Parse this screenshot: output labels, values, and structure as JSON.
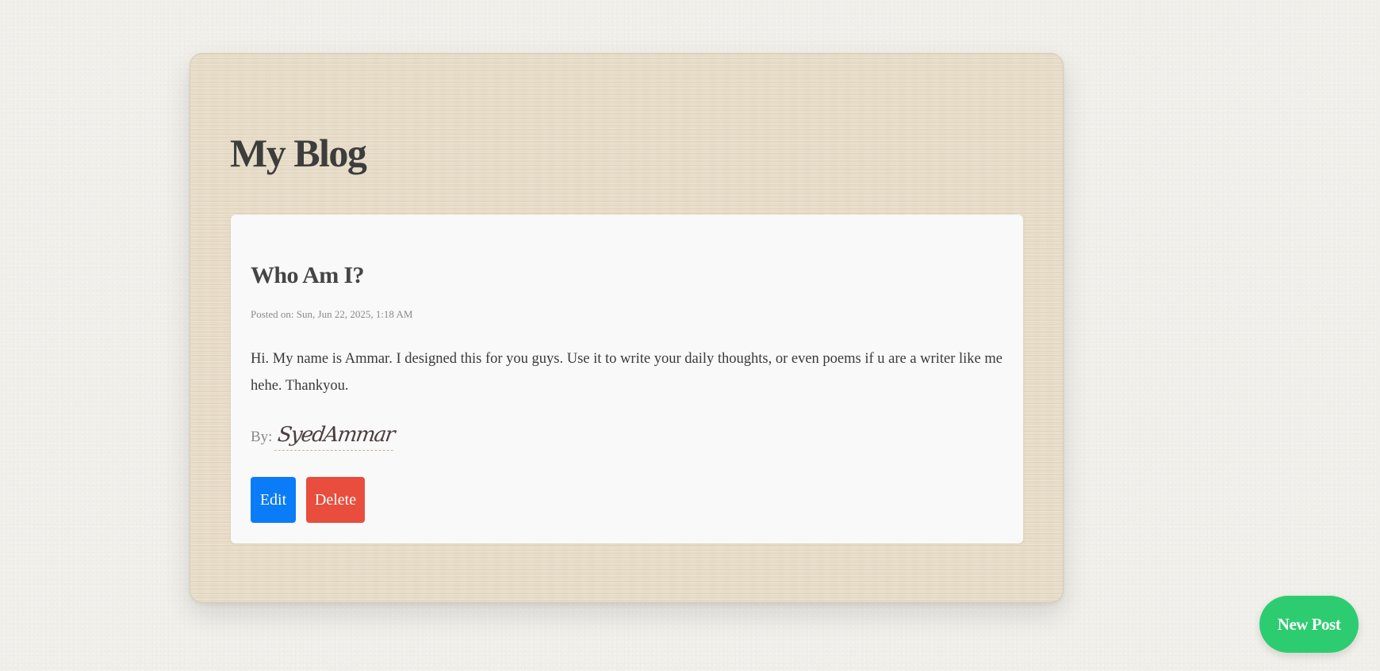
{
  "blog": {
    "title": "My Blog"
  },
  "post": {
    "title": "Who Am I?",
    "date": "Posted on: Sun, Jun 22, 2025, 1:18 AM",
    "body": "Hi. My name is Ammar. I designed this for you guys. Use it to write your daily thoughts, or even poems if u are a writer like me hehe. Thankyou.",
    "by_label": "By:",
    "author": "SyedAmmar",
    "edit_label": "Edit",
    "delete_label": "Delete"
  },
  "new_post_label": "New Post",
  "colors": {
    "page_background": "#f0efea",
    "paper": "#e6dbc6",
    "card": "#f9f9f9",
    "edit_button": "#0a7cf7",
    "delete_button": "#e84d3d",
    "new_post_button": "#2ecc71"
  }
}
